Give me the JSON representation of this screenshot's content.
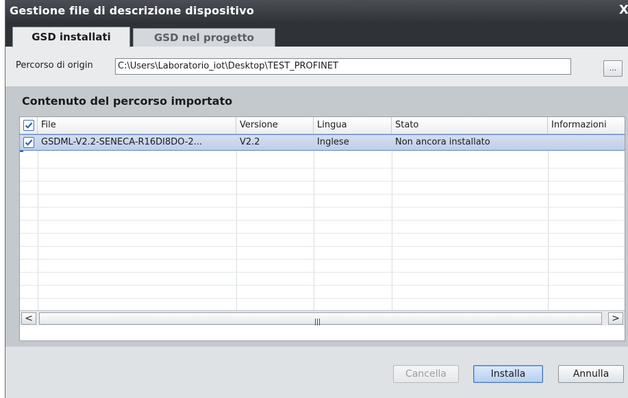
{
  "window": {
    "title": "Gestione file di descrizione dispositivo",
    "close_glyph": "X"
  },
  "tabs": [
    {
      "label": "GSD installati",
      "active": true
    },
    {
      "label": "GSD nel progetto",
      "active": false
    }
  ],
  "source_path": {
    "label": "Percorso di origin",
    "value": "C:\\Users\\Laboratorio_iot\\Desktop\\TEST_PROFINET",
    "browse_label": "..."
  },
  "content": {
    "title": "Contenuto del percorso importato",
    "columns": [
      "File",
      "Versione",
      "Lingua",
      "Stato",
      "Informazioni"
    ],
    "header_checkbox_checked": true,
    "rows": [
      {
        "checked": true,
        "file": "GSDML-V2.2-SENECA-R16DI8DO-2...",
        "version": "V2.2",
        "language": "Inglese",
        "status": "Non ancora installato",
        "info": ""
      }
    ],
    "scroll_left_icon": "chevron-left-icon",
    "scroll_right_icon": "chevron-right-icon",
    "scroll_left_glyph": "<",
    "scroll_right_glyph": ">"
  },
  "buttons": {
    "cancel": "Cancella",
    "install": "Installa",
    "abort": "Annulla"
  },
  "colors": {
    "titlebar": "#2f3338",
    "selection": "#c8d6ef",
    "checkbox": "#3d6eb6"
  }
}
